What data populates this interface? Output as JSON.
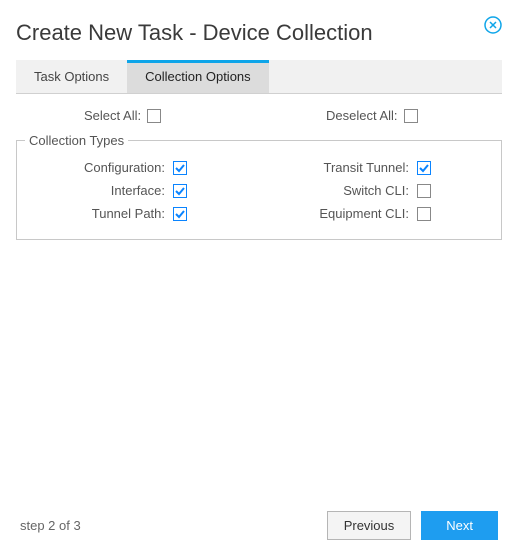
{
  "dialog": {
    "title": "Create New Task - Device Collection",
    "close_icon": "close"
  },
  "tabs": [
    {
      "label": "Task Options",
      "active": false
    },
    {
      "label": "Collection Options",
      "active": true
    }
  ],
  "toolbar": {
    "select_all_label": "Select All:",
    "select_all_checked": false,
    "deselect_all_label": "Deselect All:",
    "deselect_all_checked": false
  },
  "fieldset": {
    "legend": "Collection Types",
    "left": [
      {
        "label": "Configuration:",
        "checked": true
      },
      {
        "label": "Interface:",
        "checked": true
      },
      {
        "label": "Tunnel Path:",
        "checked": true
      }
    ],
    "right": [
      {
        "label": "Transit Tunnel:",
        "checked": true
      },
      {
        "label": "Switch CLI:",
        "checked": false
      },
      {
        "label": "Equipment CLI:",
        "checked": false
      }
    ]
  },
  "footer": {
    "step": "step 2 of 3",
    "previous": "Previous",
    "next": "Next"
  }
}
